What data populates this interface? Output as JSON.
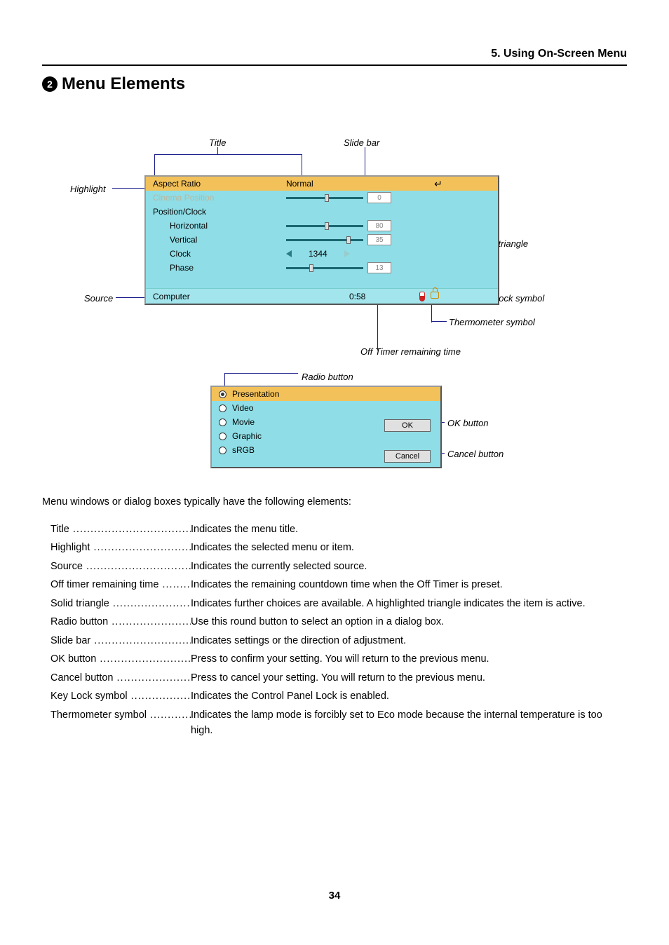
{
  "chapter": "5. Using On-Screen Menu",
  "section_num": "2",
  "section_title": "Menu Elements",
  "callouts": {
    "title": "Title",
    "slide_bar": "Slide bar",
    "highlight": "Highlight",
    "solid_triangle": "Solid triangle",
    "source": "Source",
    "key_lock": "Key Lock symbol",
    "thermometer": "Thermometer symbol",
    "off_timer": "Off Timer remaining time",
    "radio_button": "Radio button",
    "ok_button": "OK button",
    "cancel_button": "Cancel button"
  },
  "menu": {
    "aspect_ratio": "Aspect Ratio",
    "aspect_value": "Normal",
    "cinema_position": "Cinema Position",
    "cinema_value": "0",
    "position_clock": "Position/Clock",
    "horizontal": "Horizontal",
    "horizontal_value": "80",
    "vertical": "Vertical",
    "vertical_value": "35",
    "clock": "Clock",
    "clock_value": "1344",
    "phase": "Phase",
    "phase_value": "13",
    "source_label": "Computer",
    "timer": "0:58"
  },
  "radio": {
    "presentation": "Presentation",
    "video": "Video",
    "movie": "Movie",
    "graphic": "Graphic",
    "srgb": "sRGB",
    "ok": "OK",
    "cancel": "Cancel"
  },
  "intro": "Menu windows or dialog boxes typically have the following elements:",
  "definitions": [
    {
      "term": "Title",
      "desc": "Indicates the menu title."
    },
    {
      "term": "Highlight",
      "desc": "Indicates the selected menu or item."
    },
    {
      "term": "Source",
      "desc": "Indicates the currently selected source."
    },
    {
      "term": "Off timer remaining time",
      "desc": "Indicates the remaining countdown time when the Off Timer is preset."
    },
    {
      "term": "Solid triangle",
      "desc": "Indicates further choices are available. A highlighted triangle indicates the item is active."
    },
    {
      "term": "Radio button",
      "desc": "Use this round button to select an option in a dialog box."
    },
    {
      "term": "Slide bar",
      "desc": "Indicates settings or the direction of adjustment."
    },
    {
      "term": "OK button",
      "desc": "Press to confirm your setting. You will return to the previous menu."
    },
    {
      "term": "Cancel button",
      "desc": "Press to cancel your setting. You will return to the previous menu."
    },
    {
      "term": "Key Lock symbol",
      "desc": "Indicates the Control Panel Lock is enabled."
    },
    {
      "term": "Thermometer symbol",
      "desc": "Indicates the lamp mode is forcibly set to Eco mode because the internal temperature is too high."
    }
  ],
  "page_number": "34"
}
